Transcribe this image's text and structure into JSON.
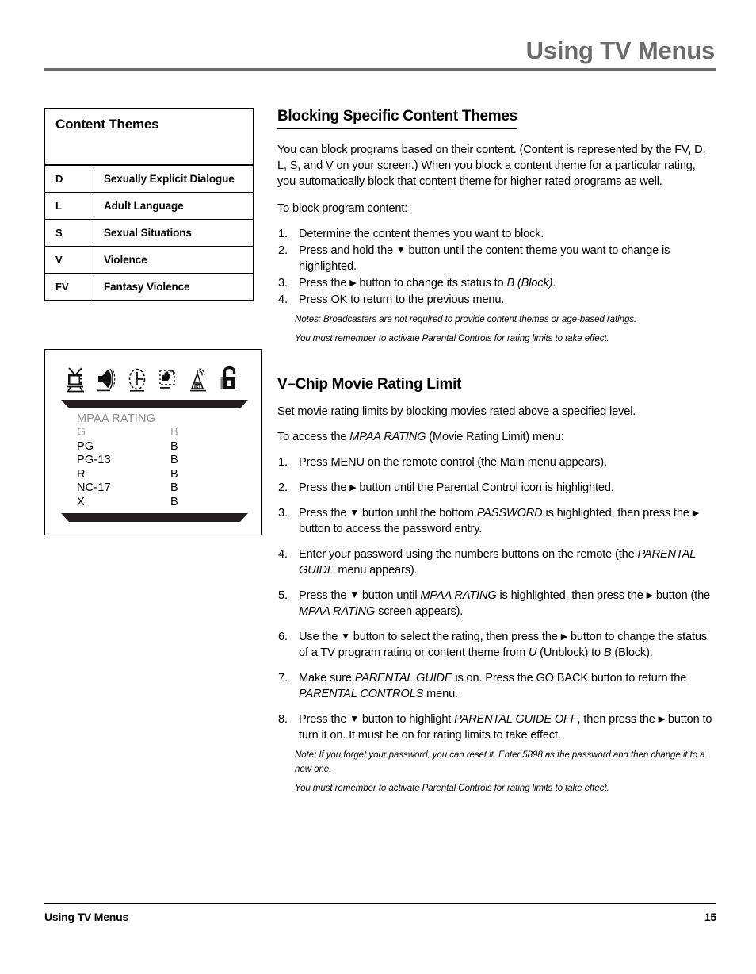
{
  "header": {
    "title": "Using TV Menus"
  },
  "footer": {
    "left": "Using TV Menus",
    "page_number": "15"
  },
  "content_themes_table": {
    "title": "Content Themes",
    "rows": [
      {
        "code": "D",
        "description": "Sexually Explicit Dialogue"
      },
      {
        "code": "L",
        "description": "Adult Language"
      },
      {
        "code": "S",
        "description": "Sexual Situations"
      },
      {
        "code": "V",
        "description": "Violence"
      },
      {
        "code": "FV",
        "description": "Fantasy Violence"
      }
    ]
  },
  "tv_menu_figure": {
    "icons": [
      {
        "name": "tv-icon",
        "selected": false
      },
      {
        "name": "audio-speaker-icon",
        "selected": false
      },
      {
        "name": "clock-icon",
        "selected": false
      },
      {
        "name": "channel-hand-icon",
        "selected": false
      },
      {
        "name": "antenna-broadcast-icon",
        "selected": false
      },
      {
        "name": "parental-lock-icon",
        "selected": true
      }
    ],
    "menu_title": "MPAA RATING",
    "ratings": [
      {
        "label": "G",
        "status": "B",
        "dim": true
      },
      {
        "label": "PG",
        "status": "B",
        "dim": false
      },
      {
        "label": "PG-13",
        "status": "B",
        "dim": false
      },
      {
        "label": "R",
        "status": "B",
        "dim": false
      },
      {
        "label": "NC-17",
        "status": "B",
        "dim": false
      },
      {
        "label": "X",
        "status": "B",
        "dim": false
      }
    ],
    "colors": {
      "bar": "#231f20",
      "dim_text": "#a5a5a5",
      "title_text": "#8c8c8c"
    }
  },
  "blocking_section": {
    "heading": "Blocking Specific Content Themes",
    "intro": "You can block programs based on their content. (Content is represented by the FV, D, L, S, and V on your screen.) When you block a content theme for a particular rating, you automatically block that content theme for higher rated programs as well.",
    "lead_in": "To block program content:",
    "steps": [
      {
        "num": "1.",
        "text_a": "Determine the content themes you want to block.",
        "text_b": "",
        "text_c": "",
        "italic_a": "",
        "italic_b": ""
      },
      {
        "num": "2.",
        "text_a": "Press and hold the ",
        "glyph": "down",
        "text_b": " button until the content theme you want to change is highlighted.",
        "text_c": ""
      },
      {
        "num": "3.",
        "text_a": "Press the ",
        "glyph": "right",
        "text_b": " button to change its status to ",
        "italic_a": "B (Block)",
        "text_c": "."
      },
      {
        "num": "4.",
        "text_a": "Press OK to return to the previous menu.",
        "text_b": "",
        "text_c": ""
      }
    ],
    "notes": [
      "Notes: Broadcasters are not required to provide content themes or age-based ratings.",
      "You must remember to activate Parental Controls for rating limits to take effect."
    ]
  },
  "vchip_section": {
    "heading": "V–Chip Movie Rating Limit",
    "intro": "Set movie rating limits by blocking movies rated above a specified level.",
    "lead_in_a": "To access the ",
    "lead_in_italic": "MPAA RATING",
    "lead_in_b": " (Movie Rating Limit) menu:",
    "steps": [
      {
        "num": "1.",
        "parts": [
          {
            "t": "Press MENU on the remote control (the Main menu appears).",
            "s": "n"
          }
        ]
      },
      {
        "num": "2.",
        "parts": [
          {
            "t": "Press the ",
            "s": "n"
          },
          {
            "t": "",
            "s": "right"
          },
          {
            "t": " button until the Parental Control icon is highlighted.",
            "s": "n"
          }
        ]
      },
      {
        "num": "3.",
        "parts": [
          {
            "t": "Press the ",
            "s": "n"
          },
          {
            "t": "",
            "s": "down"
          },
          {
            "t": " button until the bottom ",
            "s": "n"
          },
          {
            "t": "PASSWORD",
            "s": "i"
          },
          {
            "t": " is highlighted, then press the ",
            "s": "n"
          },
          {
            "t": "",
            "s": "right"
          },
          {
            "t": " button to access the password entry.",
            "s": "n"
          }
        ]
      },
      {
        "num": "4.",
        "parts": [
          {
            "t": "Enter your password using the numbers buttons on the remote (the ",
            "s": "n"
          },
          {
            "t": "PARENTAL GUIDE",
            "s": "i"
          },
          {
            "t": " menu appears).",
            "s": "n"
          }
        ]
      },
      {
        "num": "5.",
        "parts": [
          {
            "t": "Press the ",
            "s": "n"
          },
          {
            "t": "",
            "s": "down"
          },
          {
            "t": " button until ",
            "s": "n"
          },
          {
            "t": "MPAA RATING",
            "s": "i"
          },
          {
            "t": " is highlighted, then press the ",
            "s": "n"
          },
          {
            "t": "",
            "s": "right"
          },
          {
            "t": " button (the ",
            "s": "n"
          },
          {
            "t": "MPAA RATING",
            "s": "i"
          },
          {
            "t": " screen appears).",
            "s": "n"
          }
        ]
      },
      {
        "num": "6.",
        "parts": [
          {
            "t": "Use the ",
            "s": "n"
          },
          {
            "t": "",
            "s": "down"
          },
          {
            "t": " button to select the rating, then press the ",
            "s": "n"
          },
          {
            "t": "",
            "s": "right"
          },
          {
            "t": " button to change the status of a TV program rating or content theme from ",
            "s": "n"
          },
          {
            "t": "U",
            "s": "i"
          },
          {
            "t": " (Unblock) to ",
            "s": "n"
          },
          {
            "t": "B",
            "s": "i"
          },
          {
            "t": " (Block).",
            "s": "n"
          }
        ]
      },
      {
        "num": "7.",
        "parts": [
          {
            "t": "Make sure ",
            "s": "n"
          },
          {
            "t": "PARENTAL GUIDE",
            "s": "i"
          },
          {
            "t": " is on. Press the GO BACK button to return the ",
            "s": "n"
          },
          {
            "t": "PARENTAL CONTROLS",
            "s": "i"
          },
          {
            "t": " menu.",
            "s": "n"
          }
        ]
      },
      {
        "num": "8.",
        "parts": [
          {
            "t": "Press the ",
            "s": "n"
          },
          {
            "t": "",
            "s": "down"
          },
          {
            "t": " button to highlight ",
            "s": "n"
          },
          {
            "t": "PARENTAL GUIDE OFF",
            "s": "i"
          },
          {
            "t": ", then press the ",
            "s": "n"
          },
          {
            "t": "",
            "s": "right"
          },
          {
            "t": " button to turn it on. It must be on for rating limits to take effect.",
            "s": "n"
          }
        ]
      }
    ],
    "notes": [
      "Note: If you forget your password, you can reset it. Enter 5898 as the password and then change it to a new one.",
      "You must remember to activate Parental Controls for rating limits to take effect."
    ]
  }
}
